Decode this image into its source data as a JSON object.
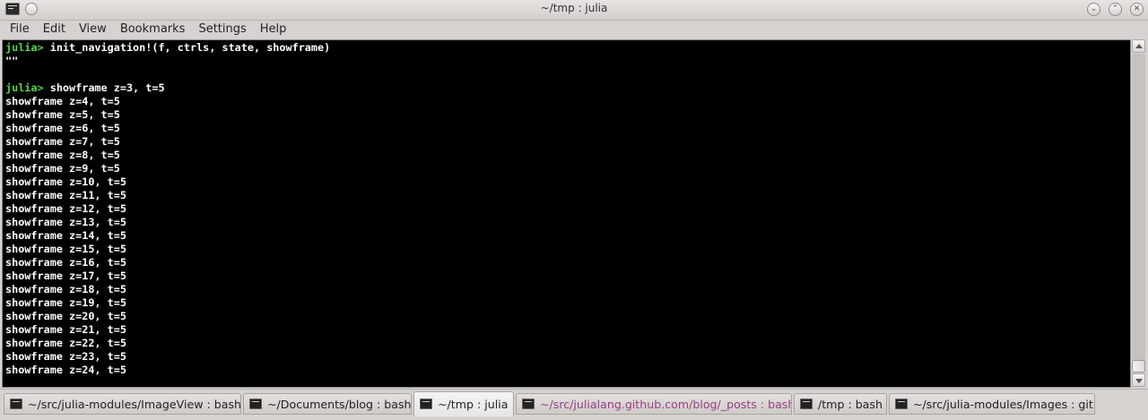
{
  "window": {
    "title": "~/tmp : julia"
  },
  "menu": [
    "File",
    "Edit",
    "View",
    "Bookmarks",
    "Settings",
    "Help"
  ],
  "terminal": {
    "lines": [
      {
        "prompt": "julia> ",
        "text": "init_navigation!(f, ctrls, state, showframe)"
      },
      {
        "prompt": "",
        "text": "\"\""
      },
      {
        "prompt": "",
        "text": ""
      },
      {
        "prompt": "julia> ",
        "text": "showframe z=3, t=5"
      },
      {
        "prompt": "",
        "text": "showframe z=4, t=5"
      },
      {
        "prompt": "",
        "text": "showframe z=5, t=5"
      },
      {
        "prompt": "",
        "text": "showframe z=6, t=5"
      },
      {
        "prompt": "",
        "text": "showframe z=7, t=5"
      },
      {
        "prompt": "",
        "text": "showframe z=8, t=5"
      },
      {
        "prompt": "",
        "text": "showframe z=9, t=5"
      },
      {
        "prompt": "",
        "text": "showframe z=10, t=5"
      },
      {
        "prompt": "",
        "text": "showframe z=11, t=5"
      },
      {
        "prompt": "",
        "text": "showframe z=12, t=5"
      },
      {
        "prompt": "",
        "text": "showframe z=13, t=5"
      },
      {
        "prompt": "",
        "text": "showframe z=14, t=5"
      },
      {
        "prompt": "",
        "text": "showframe z=15, t=5"
      },
      {
        "prompt": "",
        "text": "showframe z=16, t=5"
      },
      {
        "prompt": "",
        "text": "showframe z=17, t=5"
      },
      {
        "prompt": "",
        "text": "showframe z=18, t=5"
      },
      {
        "prompt": "",
        "text": "showframe z=19, t=5"
      },
      {
        "prompt": "",
        "text": "showframe z=20, t=5"
      },
      {
        "prompt": "",
        "text": "showframe z=21, t=5"
      },
      {
        "prompt": "",
        "text": "showframe z=22, t=5"
      },
      {
        "prompt": "",
        "text": "showframe z=23, t=5"
      },
      {
        "prompt": "",
        "text": "showframe z=24, t=5"
      }
    ],
    "scrollbar": {
      "thumb_start_fraction": 0.96,
      "thumb_end_fraction": 1.0
    }
  },
  "tabs": [
    {
      "label": "~/src/julia-modules/ImageView : bash",
      "active": false,
      "activity": false
    },
    {
      "label": "~/Documents/blog : bash",
      "active": false,
      "activity": false
    },
    {
      "label": "~/tmp : julia",
      "active": true,
      "activity": false
    },
    {
      "label": "~/src/julialang.github.com/blog/_posts : bash",
      "active": false,
      "activity": true
    },
    {
      "label": "/tmp : bash",
      "active": false,
      "activity": false
    },
    {
      "label": "~/src/julia-modules/Images : git",
      "active": false,
      "activity": false
    }
  ],
  "colors": {
    "terminal_bg": "#000000",
    "terminal_fg": "#ffffff",
    "prompt": "#56d84a",
    "activity_tab_text": "#9b3e8a"
  },
  "icons": [
    "terminal-app-icon",
    "window-menu-icon",
    "minimize-icon",
    "maximize-icon",
    "close-icon",
    "terminal-tab-icon"
  ]
}
